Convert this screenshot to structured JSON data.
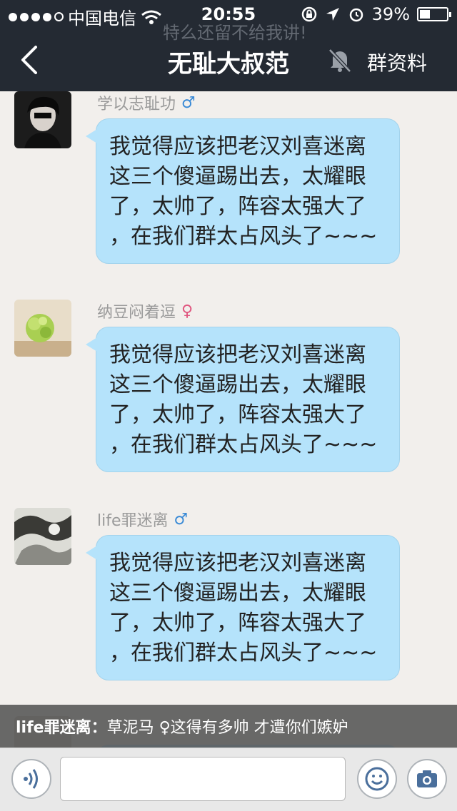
{
  "status_bar": {
    "carrier": "中国电信",
    "time": "20:55",
    "battery": "39%",
    "battery_level": 0.39
  },
  "nav": {
    "ghost_text": "特么还留不给我讲!",
    "title": "无耻大叔范",
    "action": "群资料"
  },
  "messages": [
    {
      "sender": "学以志耻功",
      "gender": "♂",
      "gender_color": "#3a8ad6",
      "lines": [
        "我觉得应该把老汉刘喜迷离",
        "这三个傻逼踢出去，太耀眼",
        "了，太帅了，阵容太强大了",
        "，在我们群太占风头了~~~"
      ]
    },
    {
      "sender": "纳豆闷着逗",
      "gender": "♀",
      "gender_color": "#e0557e",
      "lines": [
        "我觉得应该把老汉刘喜迷离",
        "这三个傻逼踢出去，太耀眼",
        "了，太帅了，阵容太强大了",
        "，在我们群太占风头了~~~"
      ]
    },
    {
      "sender": "life罪迷离",
      "gender": "♂",
      "gender_color": "#3a8ad6",
      "lines": [
        "我觉得应该把老汉刘喜迷离",
        "这三个傻逼踢出去，太耀眼",
        "了，太帅了，阵容太强大了",
        "，在我们群太占风头了~~~"
      ]
    }
  ],
  "ticker": {
    "who": "life罪迷离：",
    "text": "草泥马 ♀这得有多帅  才遭你们嫉妒"
  },
  "input": {
    "value": "",
    "placeholder": ""
  },
  "icons": {
    "back": "chevron-left-icon",
    "mute": "muted-bell-icon",
    "voice": "voice-icon",
    "emoji": "smiley-icon",
    "camera": "camera-icon"
  }
}
